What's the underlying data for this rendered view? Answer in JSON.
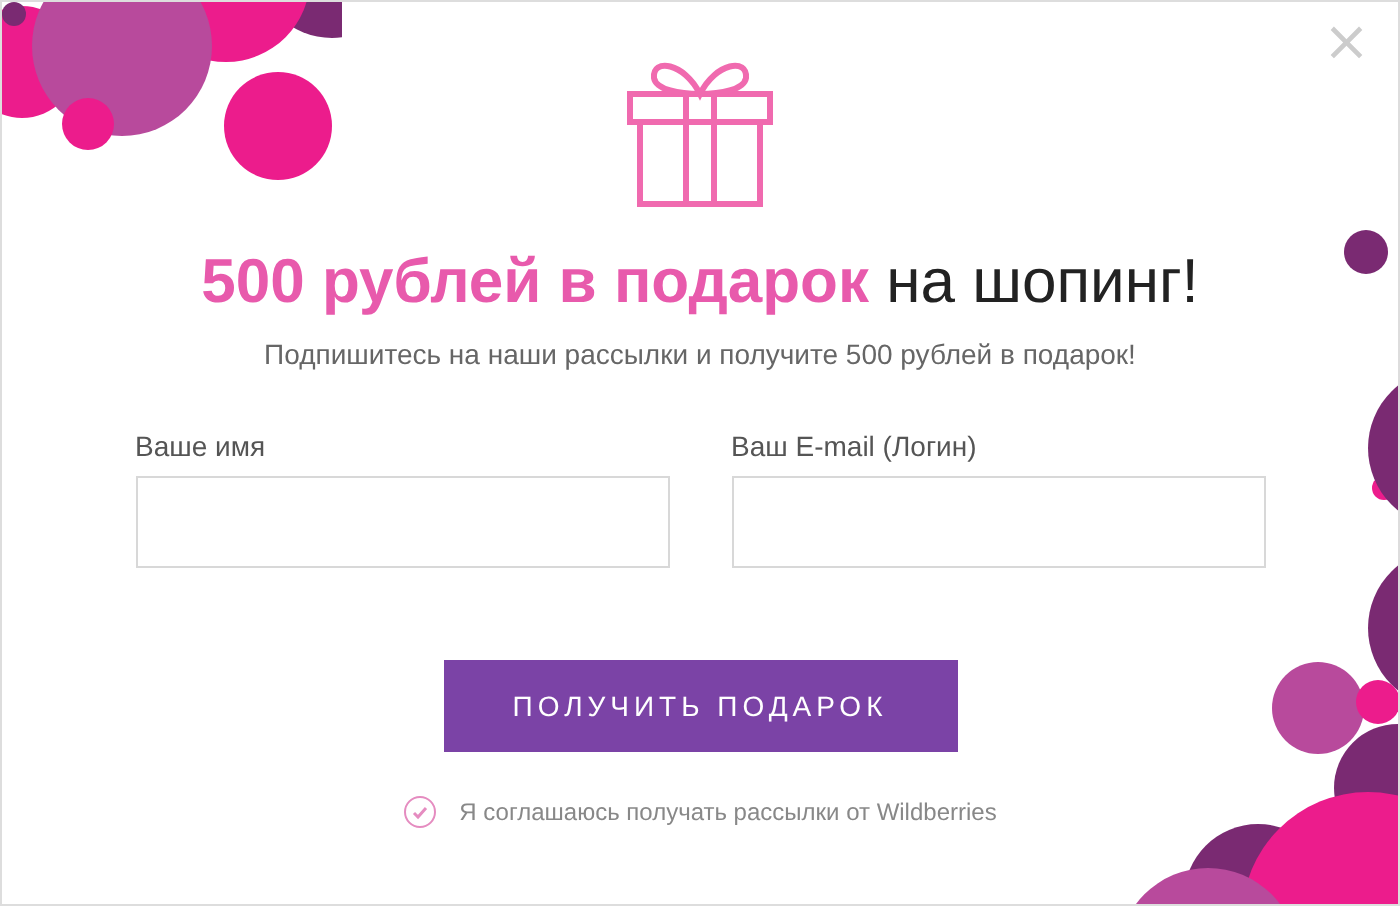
{
  "close_label": "×",
  "title": {
    "highlight": "500 рублей в подарок",
    "rest": "на шопинг!"
  },
  "subtitle": "Подпишитесь на наши рассылки и получите 500 рублей в подарок!",
  "fields": [
    {
      "label": "Ваше имя"
    },
    {
      "label": "Ваш E-mail (Логин)"
    }
  ],
  "button": "ПОЛУЧИТЬ ПОДАРОК",
  "consent": {
    "label": "Я соглашаюсь получать рассылки от Wildberries",
    "checked": true
  }
}
